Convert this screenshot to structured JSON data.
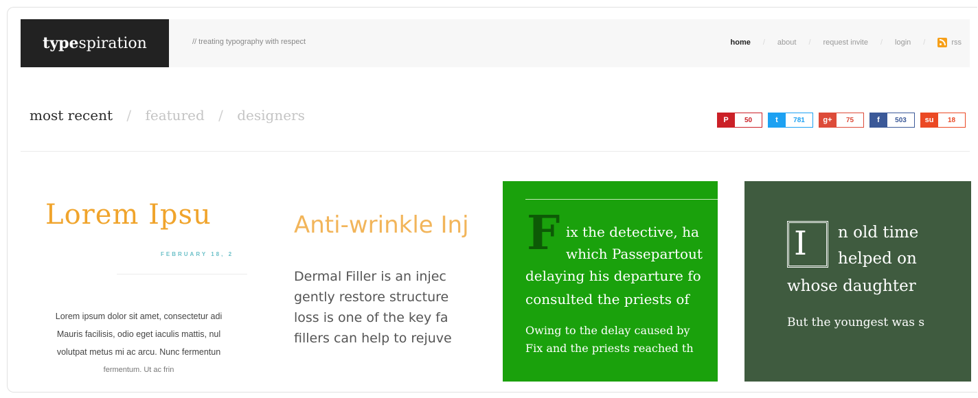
{
  "header": {
    "logo_bold": "type",
    "logo_rest": "spiration",
    "tagline": "// treating typography with respect",
    "nav": [
      {
        "label": "home"
      },
      {
        "label": "about"
      },
      {
        "label": "request invite"
      },
      {
        "label": "login"
      },
      {
        "label": "rss"
      }
    ]
  },
  "filters": {
    "tabs": [
      "most recent",
      "featured",
      "designers"
    ],
    "separator": "/"
  },
  "shares": [
    {
      "icon": "pinterest-icon",
      "glyph": "P",
      "count": "50",
      "color": "#cb2027"
    },
    {
      "icon": "twitter-icon",
      "glyph": "t",
      "count": "781",
      "color": "#1da1f2"
    },
    {
      "icon": "google-plus-icon",
      "glyph": "g+",
      "count": "75",
      "color": "#dd4b39"
    },
    {
      "icon": "facebook-icon",
      "glyph": "f",
      "count": "503",
      "color": "#3b5998"
    },
    {
      "icon": "stumbleupon-icon",
      "glyph": "su",
      "count": "18",
      "color": "#eb4924"
    }
  ],
  "cards": [
    {
      "title": "Lorem Ipsu",
      "date": "FEBRUARY 18, 2",
      "lines": [
        "Lorem ipsum dolor sit amet, consectetur adi",
        "Mauris facilisis, odio eget iaculis mattis, nul",
        "volutpat metus mi ac arcu. Nunc fermentun",
        "fermentum. Ut ac frin"
      ]
    },
    {
      "title": "Anti-wrinkle Inj",
      "lines": [
        "Dermal Filler is an injec",
        "gently restore structure",
        "loss is one of the key fa",
        "fillers can help to rejuve"
      ]
    },
    {
      "dropcap": "F",
      "lines": [
        "ix the detective, ha",
        "which Passepartout",
        "delaying his departure fo",
        "consulted the priests of",
        "Owing to the delay caused by",
        "Fix and the priests reached th"
      ]
    },
    {
      "dropcap": "I",
      "lines": [
        "n old time",
        "helped on",
        "whose daughter",
        "But the youngest was s"
      ]
    }
  ]
}
